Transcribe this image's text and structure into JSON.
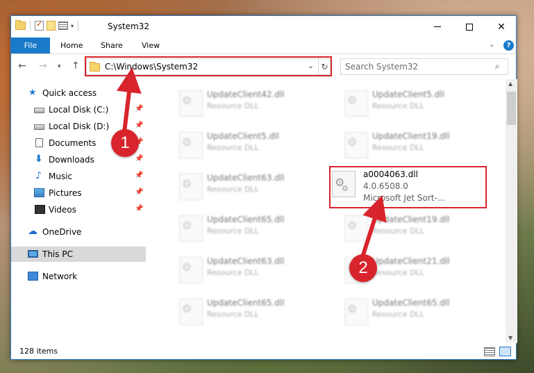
{
  "window": {
    "title": "System32",
    "controls": {
      "minimize": "minimize",
      "maximize": "maximize",
      "close": "✕"
    }
  },
  "ribbon": {
    "tabs": [
      "File",
      "Home",
      "Share",
      "View"
    ],
    "help": "?"
  },
  "address_bar": {
    "path": "C:\\Windows\\System32",
    "search_placeholder": "Search System32"
  },
  "sidebar": {
    "items": [
      {
        "label": "Quick access",
        "icon": "star-icon",
        "pinned": false
      },
      {
        "label": "Local Disk (C:)",
        "icon": "drive-icon",
        "pinned": true
      },
      {
        "label": "Local Disk (D:)",
        "icon": "drive-icon",
        "pinned": true
      },
      {
        "label": "Documents",
        "icon": "documents-icon",
        "pinned": true
      },
      {
        "label": "Downloads",
        "icon": "downloads-icon",
        "pinned": true
      },
      {
        "label": "Music",
        "icon": "music-icon",
        "pinned": true
      },
      {
        "label": "Pictures",
        "icon": "pictures-icon",
        "pinned": true
      },
      {
        "label": "Videos",
        "icon": "videos-icon",
        "pinned": true
      },
      {
        "label": "OneDrive",
        "icon": "onedrive-icon",
        "pinned": false
      },
      {
        "label": "This PC",
        "icon": "computer-icon",
        "pinned": false,
        "selected": true
      },
      {
        "label": "Network",
        "icon": "network-icon",
        "pinned": false
      }
    ]
  },
  "files": [
    {
      "name": "UpdateClient42.dll",
      "type": "Resource DLL"
    },
    {
      "name": "UpdateClient5.dll",
      "type": "Resource DLL"
    },
    {
      "name": "UpdateClient5.dll",
      "type": "Resource DLL"
    },
    {
      "name": "UpdateClient19.dll",
      "type": "Resource DLL"
    },
    {
      "name": "UpdateClient63.dll",
      "type": "Resource DLL"
    },
    {
      "name": "a0004063.dll",
      "version": "4.0.6508.0",
      "description": "Microsoft Jet Sort-...",
      "highlighted": true
    },
    {
      "name": "UpdateClient65.dll",
      "type": "Resource DLL"
    },
    {
      "name": "UpdateClient19.dll",
      "type": "Resource DLL"
    },
    {
      "name": "UpdateClient63.dll",
      "type": "Resource DLL"
    },
    {
      "name": "UpdateClient21.dll",
      "type": "Resource DLL"
    },
    {
      "name": "UpdateClient65.dll",
      "type": "Resource DLL"
    },
    {
      "name": "UpdateClient65.dll",
      "type": "Resource DLL"
    }
  ],
  "status": {
    "item_count": "128 items"
  },
  "callouts": [
    "1",
    "2"
  ],
  "colors": {
    "accent": "#1979ca",
    "highlight": "#d8242c",
    "selection": "#d9d9d9"
  }
}
